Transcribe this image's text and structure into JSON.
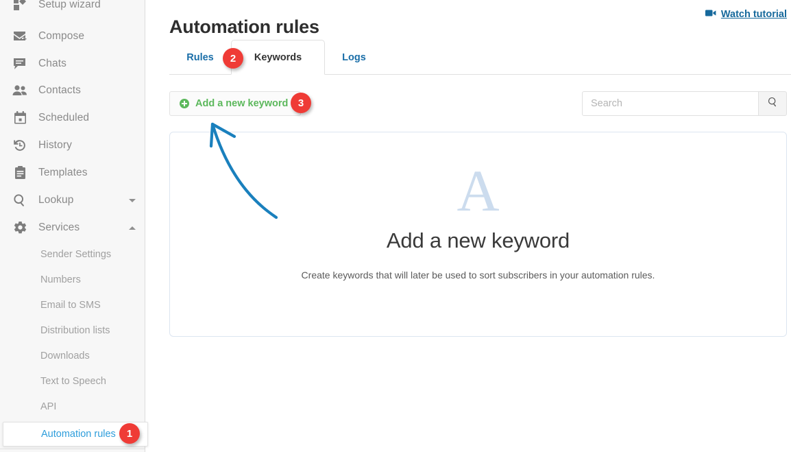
{
  "sidebar": {
    "items": [
      {
        "label": "Setup wizard",
        "icon": "grid-icon"
      },
      {
        "label": "Compose",
        "icon": "envelope-plus-icon"
      },
      {
        "label": "Chats",
        "icon": "chat-bubble-icon"
      },
      {
        "label": "Contacts",
        "icon": "people-icon"
      },
      {
        "label": "Scheduled",
        "icon": "calendar-icon"
      },
      {
        "label": "History",
        "icon": "clock-history-icon"
      },
      {
        "label": "Templates",
        "icon": "clipboard-icon"
      },
      {
        "label": "Lookup",
        "icon": "search-icon",
        "chevron": "down"
      },
      {
        "label": "Services",
        "icon": "gear-icon",
        "chevron": "up"
      }
    ],
    "sub_items": [
      {
        "label": "Sender Settings"
      },
      {
        "label": "Numbers"
      },
      {
        "label": "Email to SMS"
      },
      {
        "label": "Distribution lists"
      },
      {
        "label": "Downloads"
      },
      {
        "label": "Text to Speech"
      },
      {
        "label": "API"
      }
    ],
    "active_item": {
      "label": "Automation rules"
    }
  },
  "header": {
    "title": "Automation rules",
    "watch_tutorial": "Watch tutorial",
    "watch_tutorial_icon": "video-camera-icon"
  },
  "tabs": [
    {
      "label": "Rules",
      "active": false
    },
    {
      "label": "Keywords",
      "active": true
    },
    {
      "label": "Logs",
      "active": false
    }
  ],
  "toolbar": {
    "add_keyword_label": "Add a new keyword",
    "add_keyword_icon": "plus-circle-icon",
    "search_placeholder": "Search",
    "search_value": "",
    "search_icon": "magnifier-icon"
  },
  "empty_state": {
    "letter": "A",
    "title": "Add a new keyword",
    "description": "Create keywords that will later be used to sort subscribers in your automation rules."
  },
  "annotations": {
    "badges": [
      {
        "id": "1",
        "target": "sidebar-item-automation-rules"
      },
      {
        "id": "2",
        "target": "tab-keywords"
      },
      {
        "id": "3",
        "target": "add-new-keyword-button"
      }
    ],
    "arrow_color": "#1a80bd"
  },
  "colors": {
    "accent_blue": "#2d9ddb",
    "link_blue": "#1a6ea8",
    "green": "#5cb85c",
    "badge_red": "#ef3b36",
    "sidebar_bg": "#f7f7f7",
    "empty_letter": "#ccdcee"
  }
}
